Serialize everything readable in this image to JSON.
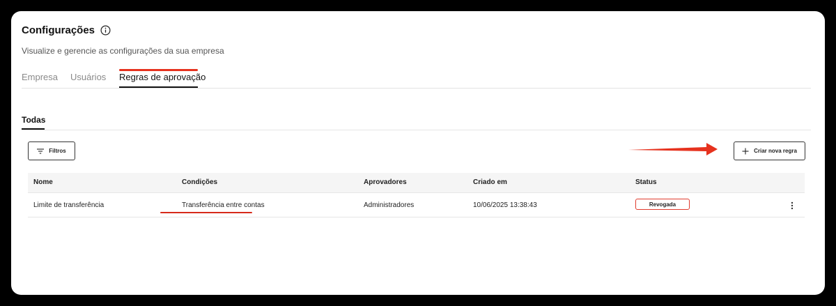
{
  "header": {
    "title": "Configurações",
    "subtitle": "Visualize e gerencie as configurações da sua empresa"
  },
  "tabs": [
    {
      "label": "Empresa",
      "active": false
    },
    {
      "label": "Usuários",
      "active": false
    },
    {
      "label": "Regras de aprovação",
      "active": true
    }
  ],
  "subtabs": [
    {
      "label": "Todas",
      "active": true
    }
  ],
  "toolbar": {
    "filter_label": "Filtros",
    "create_label": "Criar nova regra"
  },
  "table": {
    "columns": [
      "Nome",
      "Condições",
      "Aprovadores",
      "Criado em",
      "Status"
    ],
    "rows": [
      {
        "name": "Limite de transferência",
        "conditions": "Transferência entre contas",
        "approvers": "Administradores",
        "created_at": "10/06/2025 13:38:43",
        "status": "Revogada"
      }
    ]
  },
  "colors": {
    "annotation_red": "#e6321e",
    "status_border": "#e03a2d",
    "background": "#000000",
    "card": "#ffffff"
  },
  "icons": {
    "title": "info-icon",
    "filter": "filter-icon",
    "create": "plus-icon",
    "row_actions": "more-vertical-icon"
  }
}
